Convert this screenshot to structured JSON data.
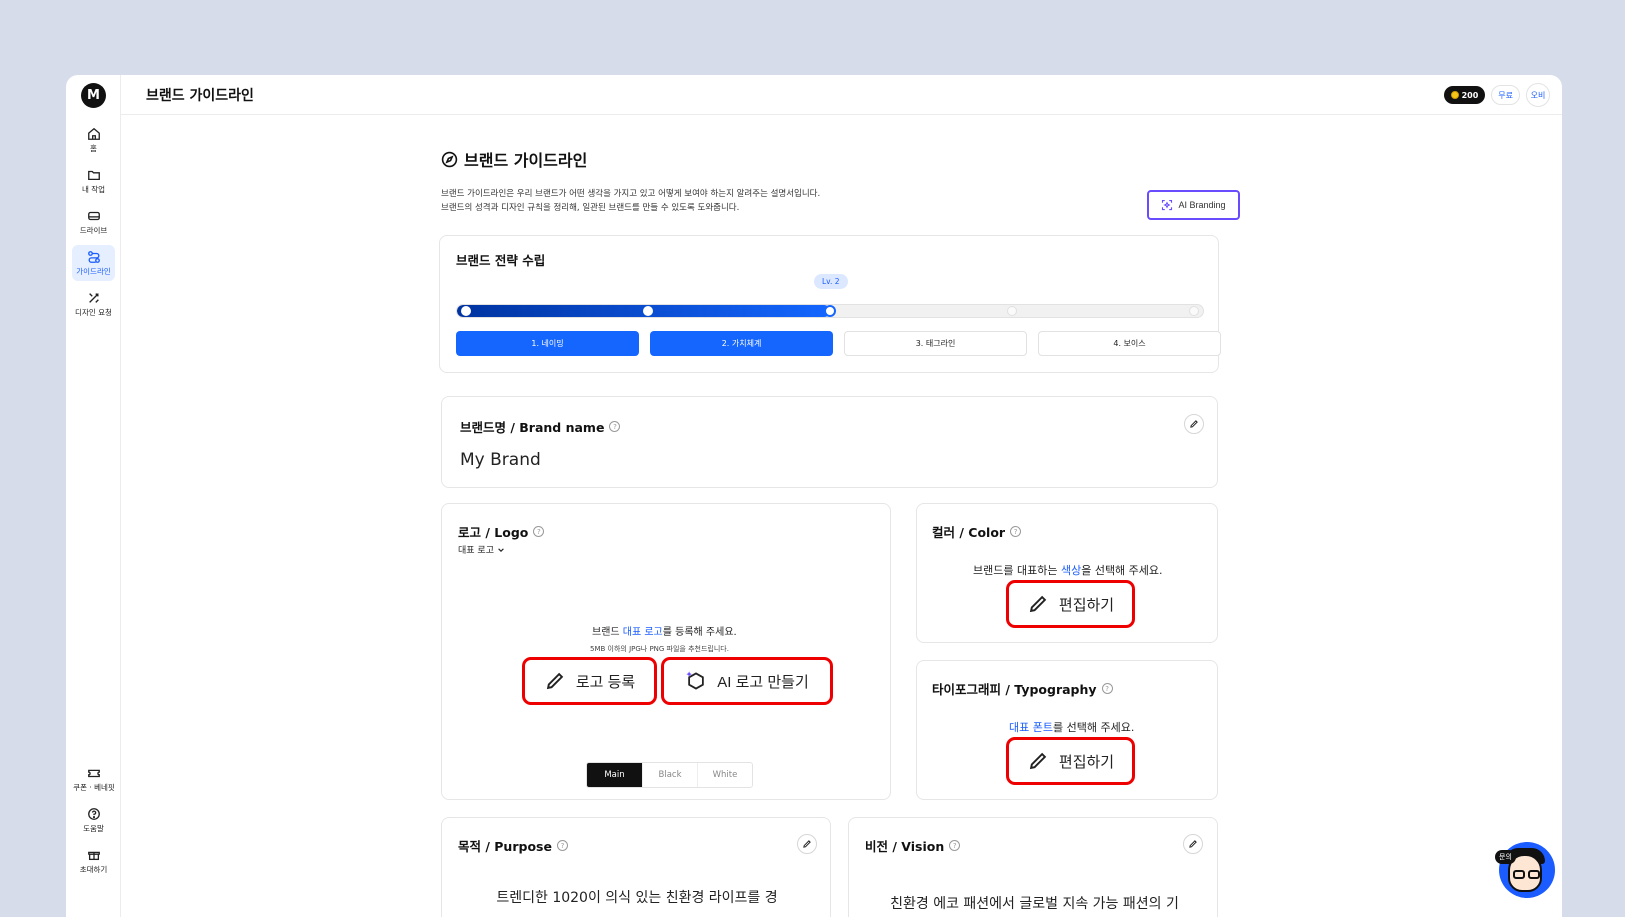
{
  "sidebar": {
    "logo": "M",
    "items": [
      {
        "label": "홈",
        "icon": "home-icon"
      },
      {
        "label": "내 작업",
        "icon": "folder-icon"
      },
      {
        "label": "드라이브",
        "icon": "drive-icon"
      },
      {
        "label": "가이드라인",
        "icon": "route-icon"
      },
      {
        "label": "디자인 요청",
        "icon": "design-tools-icon"
      }
    ],
    "bottom_items": [
      {
        "label": "쿠폰 · 베네핏",
        "icon": "ticket-icon"
      },
      {
        "label": "도움말",
        "icon": "help-icon"
      },
      {
        "label": "초대하기",
        "icon": "gift-icon"
      }
    ]
  },
  "topbar": {
    "title": "브랜드 가이드라인",
    "coins": "200",
    "plan": "무료",
    "avatar": "오비"
  },
  "header": {
    "title": "브랜드 가이드라인",
    "desc_line1": "브랜드 가이드라인은 우리 브랜드가 어떤 생각을 가지고 있고 어떻게 보여야 하는지 알려주는 설명서입니다.",
    "desc_line2": "브랜드의 성격과 디자인 규칙을 정리해, 일관된 브랜드를 만들 수 있도록 도와줍니다.",
    "ai_button": "AI Branding"
  },
  "strategy": {
    "title": "브랜드 전략 수립",
    "level": "Lv. 2",
    "progress_fraction": 0.5,
    "steps": [
      {
        "label": "1. 네이밍",
        "done": true
      },
      {
        "label": "2. 가치체계",
        "done": true
      },
      {
        "label": "3. 태그라인",
        "done": false
      },
      {
        "label": "4. 보이스",
        "done": false
      }
    ]
  },
  "brand_name": {
    "title": "브랜드명 / Brand name",
    "value": "My Brand"
  },
  "logo": {
    "title": "로고 / Logo",
    "selector": "대표 로고",
    "prompt_pre": "브랜드 ",
    "prompt_link": "대표 로고",
    "prompt_post": "를 등록해 주세요.",
    "hint": "5MB 이하의 JPG나 PNG 파일을 추천드립니다.",
    "register_button": "로고 등록",
    "ai_button": "AI 로고 만들기",
    "variants": [
      "Main",
      "Black",
      "White"
    ],
    "selected_variant": "Main"
  },
  "color": {
    "title": "컬러 / Color",
    "prompt_pre": "브랜드를 대표하는 ",
    "prompt_link": "색상",
    "prompt_post": "을 선택해 주세요.",
    "edit_button": "편집하기"
  },
  "typography": {
    "title": "타이포그래피 / Typography",
    "prompt_link": "대표 폰트",
    "prompt_post": "를 선택해 주세요.",
    "edit_button": "편집하기"
  },
  "purpose": {
    "title": "목적 / Purpose",
    "text": "트렌디한 1020이 의식 있는 친환경 라이프를 경"
  },
  "vision": {
    "title": "비전 / Vision",
    "text": "친환경 에코 패션에서 글로벌 지속 가능 패션의 기"
  },
  "chat": {
    "badge": "문의"
  }
}
